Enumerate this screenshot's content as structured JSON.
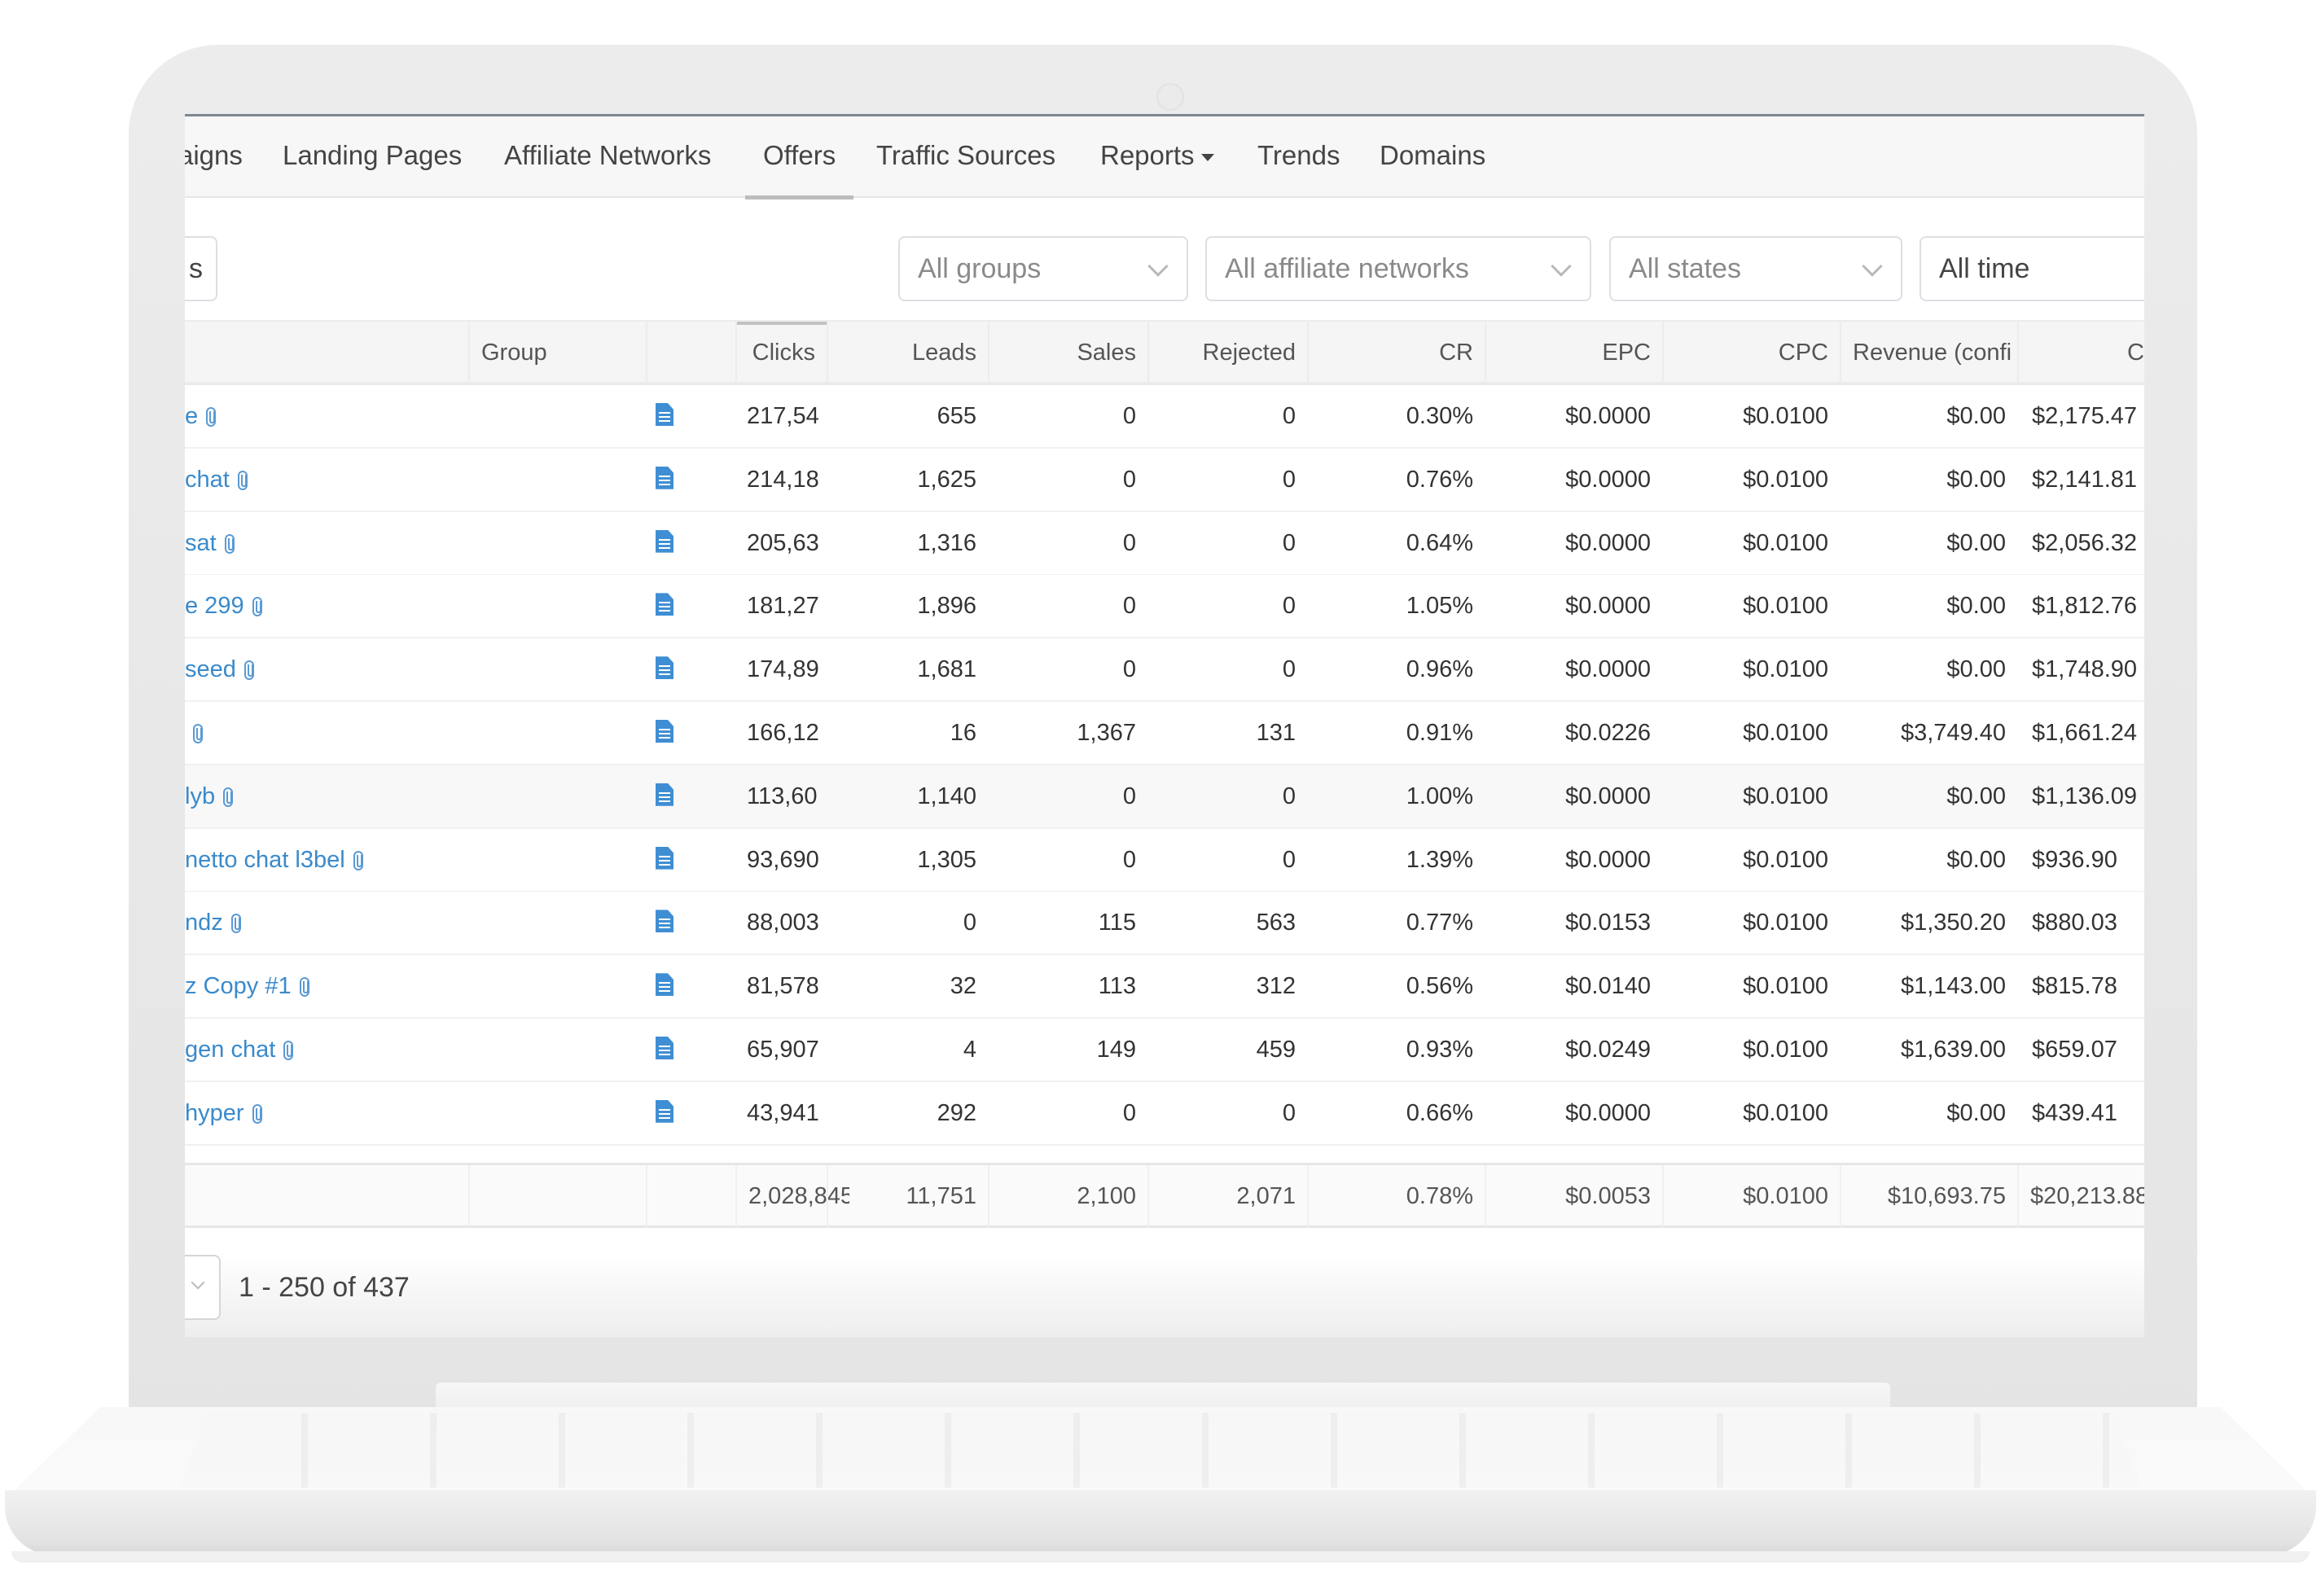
{
  "nav": {
    "items": [
      {
        "label": "aigns",
        "active": false
      },
      {
        "label": "Landing Pages",
        "active": false
      },
      {
        "label": "Affiliate Networks",
        "active": false
      },
      {
        "label": "Offers",
        "active": true
      },
      {
        "label": "Traffic Sources",
        "active": false
      },
      {
        "label": "Reports",
        "active": false,
        "dropdown": true
      },
      {
        "label": "Trends",
        "active": false
      },
      {
        "label": "Domains",
        "active": false
      }
    ]
  },
  "toolbar": {
    "left_button_label": "s",
    "filters": [
      {
        "value": "All groups",
        "icon": "chevron-down-icon"
      },
      {
        "value": "All affiliate networks",
        "icon": "chevron-down-icon"
      },
      {
        "value": "All states",
        "icon": "chevron-down-icon"
      },
      {
        "value": "All time"
      }
    ]
  },
  "table": {
    "columns": [
      "",
      "Group",
      "",
      "Clicks",
      "Leads",
      "Sales",
      "Rejected",
      "CR",
      "EPC",
      "CPC",
      "Revenue (confi",
      "C"
    ],
    "sorted_column": "Clicks",
    "rows": [
      {
        "name": "e",
        "group": "",
        "clicks": "217,54",
        "leads": "655",
        "sales": "0",
        "rejected": "0",
        "cr": "0.30%",
        "epc": "$0.0000",
        "cpc": "$0.0100",
        "revenue": "$0.00",
        "cost": "$2,175.47"
      },
      {
        "name": "chat",
        "group": "",
        "clicks": "214,18",
        "leads": "1,625",
        "sales": "0",
        "rejected": "0",
        "cr": "0.76%",
        "epc": "$0.0000",
        "cpc": "$0.0100",
        "revenue": "$0.00",
        "cost": "$2,141.81"
      },
      {
        "name": "sat",
        "group": "",
        "clicks": "205,63",
        "leads": "1,316",
        "sales": "0",
        "rejected": "0",
        "cr": "0.64%",
        "epc": "$0.0000",
        "cpc": "$0.0100",
        "revenue": "$0.00",
        "cost": "$2,056.32"
      },
      {
        "name": "e 299",
        "group": "",
        "clicks": "181,27",
        "leads": "1,896",
        "sales": "0",
        "rejected": "0",
        "cr": "1.05%",
        "epc": "$0.0000",
        "cpc": "$0.0100",
        "revenue": "$0.00",
        "cost": "$1,812.76"
      },
      {
        "name": "seed",
        "group": "",
        "clicks": "174,89",
        "leads": "1,681",
        "sales": "0",
        "rejected": "0",
        "cr": "0.96%",
        "epc": "$0.0000",
        "cpc": "$0.0100",
        "revenue": "$0.00",
        "cost": "$1,748.90"
      },
      {
        "name": "",
        "group": "",
        "clicks": "166,12",
        "leads": "16",
        "sales": "1,367",
        "rejected": "131",
        "cr": "0.91%",
        "epc": "$0.0226",
        "cpc": "$0.0100",
        "revenue": "$3,749.40",
        "cost": "$1,661.24"
      },
      {
        "name": "lyb",
        "group": "",
        "clicks": "113,60",
        "leads": "1,140",
        "sales": "0",
        "rejected": "0",
        "cr": "1.00%",
        "epc": "$0.0000",
        "cpc": "$0.0100",
        "revenue": "$0.00",
        "cost": "$1,136.09",
        "hover": true
      },
      {
        "name": "netto chat l3bel",
        "group": "",
        "clicks": "93,690",
        "leads": "1,305",
        "sales": "0",
        "rejected": "0",
        "cr": "1.39%",
        "epc": "$0.0000",
        "cpc": "$0.0100",
        "revenue": "$0.00",
        "cost": "$936.90"
      },
      {
        "name": "ndz",
        "group": "",
        "clicks": "88,003",
        "leads": "0",
        "sales": "115",
        "rejected": "563",
        "cr": "0.77%",
        "epc": "$0.0153",
        "cpc": "$0.0100",
        "revenue": "$1,350.20",
        "cost": "$880.03"
      },
      {
        "name": "z Copy #1",
        "group": "",
        "clicks": "81,578",
        "leads": "32",
        "sales": "113",
        "rejected": "312",
        "cr": "0.56%",
        "epc": "$0.0140",
        "cpc": "$0.0100",
        "revenue": "$1,143.00",
        "cost": "$815.78"
      },
      {
        "name": "gen chat",
        "group": "",
        "clicks": "65,907",
        "leads": "4",
        "sales": "149",
        "rejected": "459",
        "cr": "0.93%",
        "epc": "$0.0249",
        "cpc": "$0.0100",
        "revenue": "$1,639.00",
        "cost": "$659.07"
      },
      {
        "name": "hyper",
        "group": "",
        "clicks": "43,941",
        "leads": "292",
        "sales": "0",
        "rejected": "0",
        "cr": "0.66%",
        "epc": "$0.0000",
        "cpc": "$0.0100",
        "revenue": "$0.00",
        "cost": "$439.41"
      }
    ],
    "totals": {
      "clicks": "2,028,845",
      "leads": "11,751",
      "sales": "2,100",
      "rejected": "2,071",
      "cr": "0.78%",
      "epc": "$0.0053",
      "cpc": "$0.0100",
      "revenue": "$10,693.75",
      "cost": "$20,213.88"
    }
  },
  "pagination": {
    "range_text": "1 - 250 of 437"
  },
  "colors": {
    "link": "#3a8acb",
    "doc_icon": "#3f8ed3",
    "header_bg": "#f5f5f5",
    "nav_bg": "#f7f7f7"
  }
}
